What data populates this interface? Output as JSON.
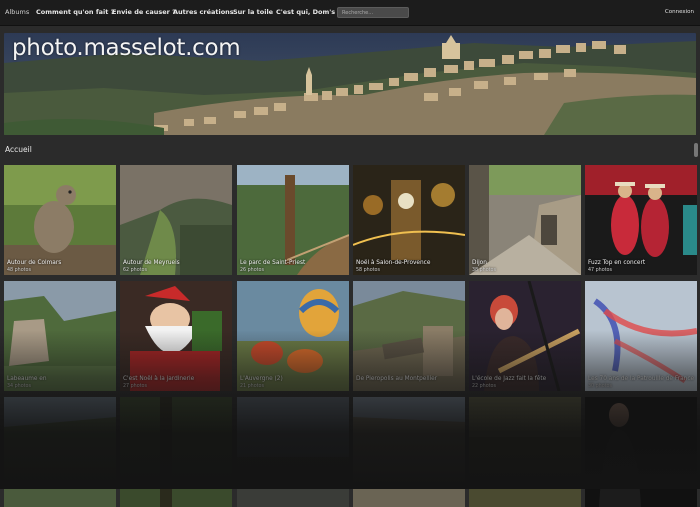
{
  "nav": {
    "albums": "Albums",
    "items": [
      "Comment qu'on fait ?",
      "Envie de causer ?",
      "Autres créations",
      "Sur la toile",
      "C'est qui, Dom's ?"
    ],
    "search_placeholder": "Recherche...",
    "login": "Connexion"
  },
  "banner": {
    "title": "photo.masselot.com"
  },
  "breadcrumb": "Accueil",
  "albums": [
    {
      "title": "Autour de Colmars",
      "count": "48 photos",
      "scene": "marmot"
    },
    {
      "title": "Autour de Meyrueis",
      "count": "62 photos",
      "scene": "cave"
    },
    {
      "title": "Le parc de Saint-Priest",
      "count": "26 photos",
      "scene": "park"
    },
    {
      "title": "Noël à Salon-de-Provence",
      "count": "58 photos",
      "scene": "xmas-lights"
    },
    {
      "title": "Dijon",
      "count": "38 photos",
      "scene": "street"
    },
    {
      "title": "Fuzz Top en concert",
      "count": "47 photos",
      "scene": "concert"
    },
    {
      "title": "Labeaume en",
      "count": "34 photos",
      "scene": "gorge"
    },
    {
      "title": "C'est Noël à la jardinerie",
      "count": "27 photos",
      "scene": "santa"
    },
    {
      "title": "L'Auvergne (2)",
      "count": "21 photos",
      "scene": "balloons"
    },
    {
      "title": "De Pieropolis au Montpellier",
      "count": "",
      "scene": "ruins"
    },
    {
      "title": "L'école de Jazz fait la fête",
      "count": "22 photos",
      "scene": "guitarist"
    },
    {
      "title": "Les 70 ans de la Patrouille de France",
      "count": "30 photos",
      "scene": "smoke"
    },
    {
      "title": "",
      "count": "",
      "scene": "dark-land"
    },
    {
      "title": "",
      "count": "",
      "scene": "dark-forest"
    },
    {
      "title": "",
      "count": "",
      "scene": "dark-sky"
    },
    {
      "title": "",
      "count": "",
      "scene": "dark-cliff"
    },
    {
      "title": "",
      "count": "",
      "scene": "dark-field"
    },
    {
      "title": "",
      "count": "",
      "scene": "dark-man"
    }
  ]
}
